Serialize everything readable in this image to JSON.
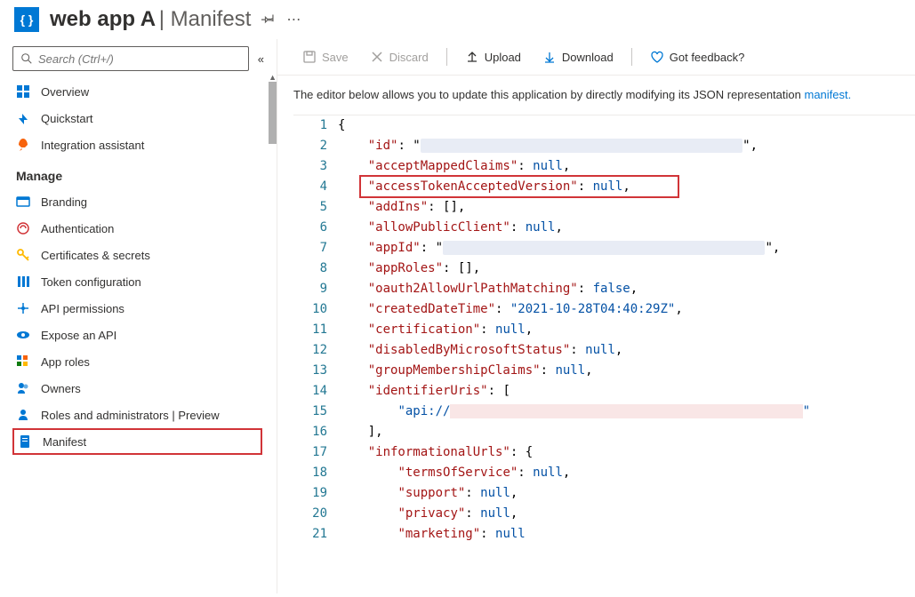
{
  "header": {
    "app_name": "web app A",
    "page_name": "Manifest"
  },
  "search": {
    "placeholder": "Search (Ctrl+/)"
  },
  "nav": {
    "top": [
      {
        "label": "Overview",
        "icon": "overview",
        "color": "#0078d4"
      },
      {
        "label": "Quickstart",
        "icon": "quickstart",
        "color": "#0078d4"
      },
      {
        "label": "Integration assistant",
        "icon": "rocket",
        "color": "#f7630c"
      }
    ],
    "manage_header": "Manage",
    "manage": [
      {
        "label": "Branding",
        "icon": "branding",
        "color": "#0078d4"
      },
      {
        "label": "Authentication",
        "icon": "auth",
        "color": "#d13438"
      },
      {
        "label": "Certificates & secrets",
        "icon": "key",
        "color": "#ffb900"
      },
      {
        "label": "Token configuration",
        "icon": "token",
        "color": "#0078d4"
      },
      {
        "label": "API permissions",
        "icon": "api-perm",
        "color": "#0078d4"
      },
      {
        "label": "Expose an API",
        "icon": "expose",
        "color": "#0078d4"
      },
      {
        "label": "App roles",
        "icon": "approles",
        "color": "#0078d4"
      },
      {
        "label": "Owners",
        "icon": "owners",
        "color": "#0078d4"
      },
      {
        "label": "Roles and administrators | Preview",
        "icon": "roles",
        "color": "#0078d4"
      },
      {
        "label": "Manifest",
        "icon": "manifest",
        "color": "#0078d4",
        "selected": true
      }
    ]
  },
  "toolbar": {
    "save": "Save",
    "discard": "Discard",
    "upload": "Upload",
    "download": "Download",
    "feedback": "Got feedback?"
  },
  "description": {
    "text_prefix": "The editor below allows you to update this application by directly modifying its JSON representation",
    "link_text": "manifest."
  },
  "code": {
    "lines": [
      {
        "n": 1,
        "indent": 0,
        "raw": "{"
      },
      {
        "n": 2,
        "indent": 1,
        "key": "id",
        "value_type": "redacted",
        "trailing": ","
      },
      {
        "n": 3,
        "indent": 1,
        "key": "acceptMappedClaims",
        "value_type": "null",
        "trailing": ","
      },
      {
        "n": 4,
        "indent": 1,
        "key": "accessTokenAcceptedVersion",
        "value_type": "null",
        "trailing": ",",
        "highlight": true
      },
      {
        "n": 5,
        "indent": 1,
        "key": "addIns",
        "value_type": "array_empty",
        "trailing": ","
      },
      {
        "n": 6,
        "indent": 1,
        "key": "allowPublicClient",
        "value_type": "null",
        "trailing": ","
      },
      {
        "n": 7,
        "indent": 1,
        "key": "appId",
        "value_type": "redacted",
        "trailing": ","
      },
      {
        "n": 8,
        "indent": 1,
        "key": "appRoles",
        "value_type": "array_empty",
        "trailing": ","
      },
      {
        "n": 9,
        "indent": 1,
        "key": "oauth2AllowUrlPathMatching",
        "value_type": "false",
        "trailing": ","
      },
      {
        "n": 10,
        "indent": 1,
        "key": "createdDateTime",
        "value_type": "string",
        "value": "2021-10-28T04:40:29Z",
        "trailing": ","
      },
      {
        "n": 11,
        "indent": 1,
        "key": "certification",
        "value_type": "null",
        "trailing": ","
      },
      {
        "n": 12,
        "indent": 1,
        "key": "disabledByMicrosoftStatus",
        "value_type": "null",
        "trailing": ","
      },
      {
        "n": 13,
        "indent": 1,
        "key": "groupMembershipClaims",
        "value_type": "null",
        "trailing": ","
      },
      {
        "n": 14,
        "indent": 1,
        "key": "identifierUris",
        "value_type": "array_open"
      },
      {
        "n": 15,
        "indent": 2,
        "value_type": "string_redacted",
        "value_prefix": "api://"
      },
      {
        "n": 16,
        "indent": 1,
        "raw": "],"
      },
      {
        "n": 17,
        "indent": 1,
        "key": "informationalUrls",
        "value_type": "object_open"
      },
      {
        "n": 18,
        "indent": 2,
        "key": "termsOfService",
        "value_type": "null",
        "trailing": ","
      },
      {
        "n": 19,
        "indent": 2,
        "key": "support",
        "value_type": "null",
        "trailing": ","
      },
      {
        "n": 20,
        "indent": 2,
        "key": "privacy",
        "value_type": "null",
        "trailing": ","
      },
      {
        "n": 21,
        "indent": 2,
        "key": "marketing",
        "value_type": "null"
      }
    ]
  }
}
